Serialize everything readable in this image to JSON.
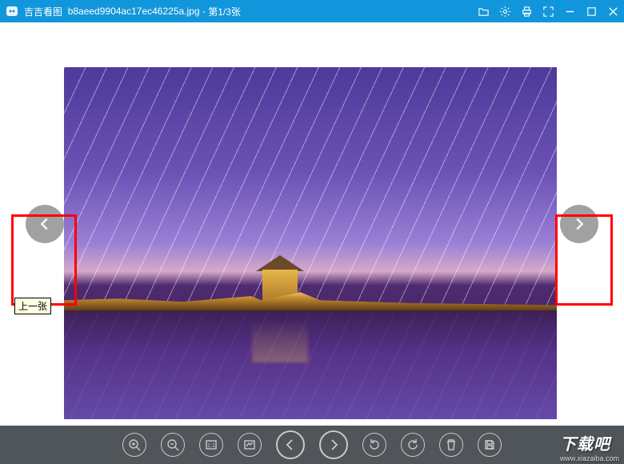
{
  "title": {
    "app_name": "吉吉看图",
    "file_name": "b8aeed9904ac17ec46225a.jpg",
    "position": "第1/3张"
  },
  "nav": {
    "prev_tooltip": "上一张"
  },
  "watermark": {
    "brand": "下载吧",
    "url": "www.xiazaiba.com"
  },
  "toolbar": {
    "zoom_in": "zoom-in",
    "zoom_out": "zoom-out",
    "fit": "fit-to-screen",
    "actual": "actual-size",
    "prev": "prev-image",
    "next": "next-image",
    "rotate_ccw": "rotate-left",
    "rotate_cw": "rotate-right",
    "delete": "delete",
    "save": "save"
  }
}
